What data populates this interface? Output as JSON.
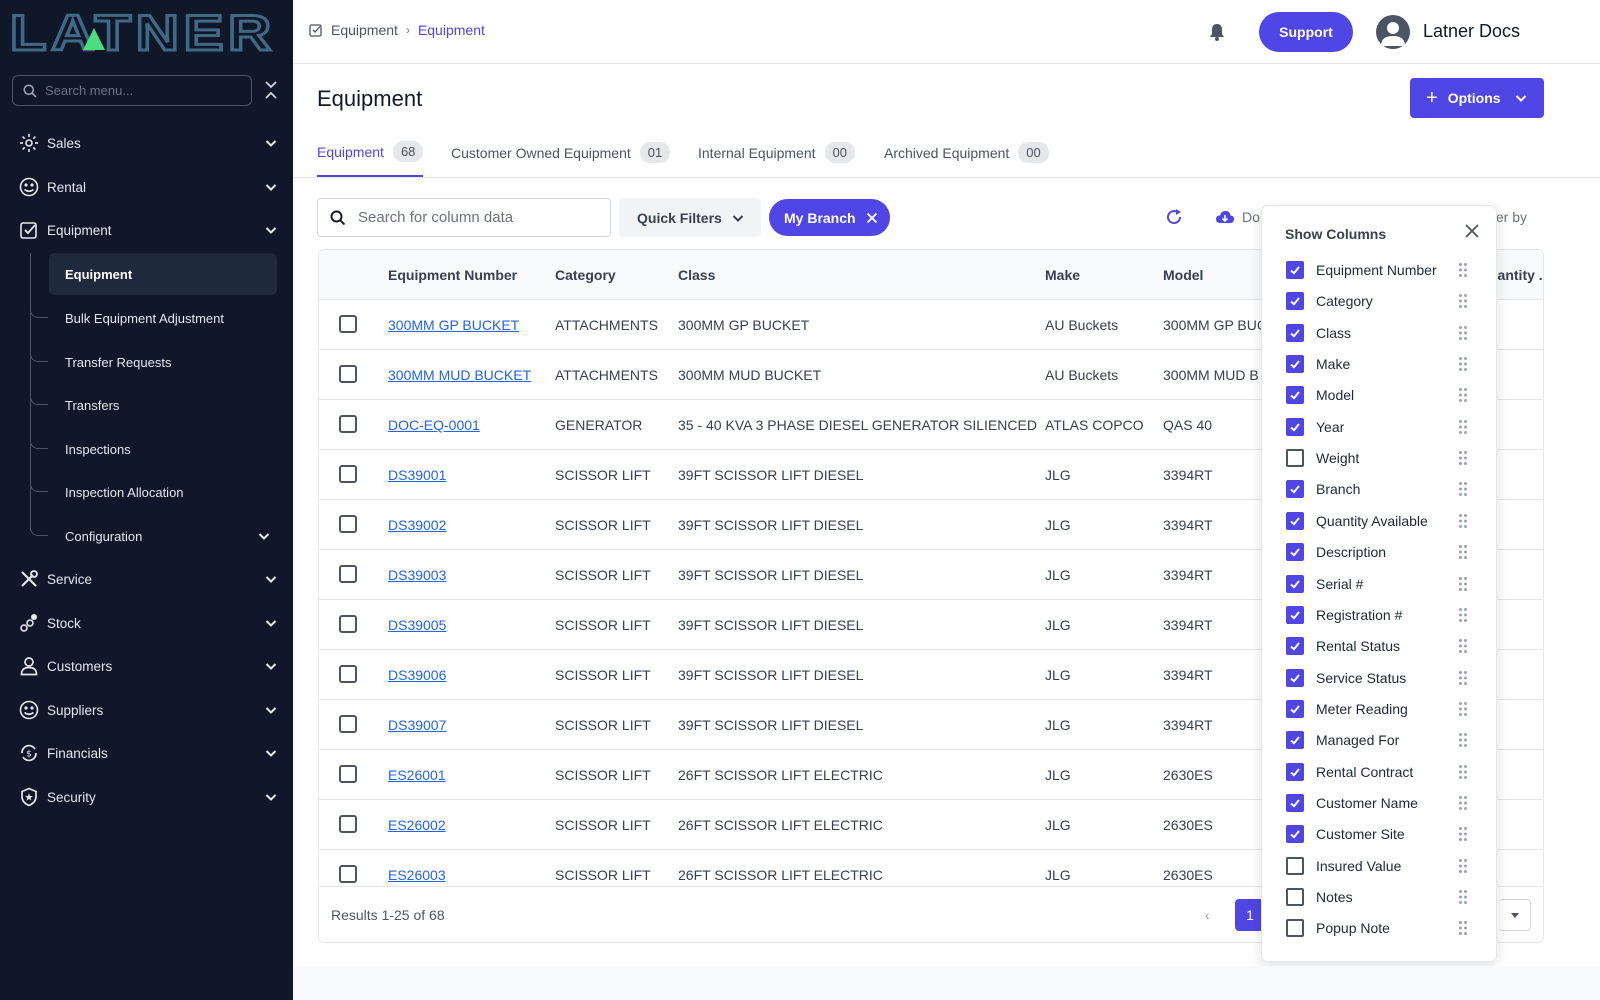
{
  "brand": {
    "logo_text": "LATNER",
    "accent": "#4f46e5",
    "sidebar_bg": "#0f1729"
  },
  "sidebar": {
    "search_placeholder": "Search menu...",
    "items": [
      {
        "label": "Sales",
        "icon": "sales-icon"
      },
      {
        "label": "Rental",
        "icon": "rental-icon"
      },
      {
        "label": "Equipment",
        "icon": "equipment-icon"
      },
      {
        "label": "Service",
        "icon": "service-icon"
      },
      {
        "label": "Stock",
        "icon": "stock-icon"
      },
      {
        "label": "Customers",
        "icon": "customers-icon"
      },
      {
        "label": "Suppliers",
        "icon": "suppliers-icon"
      },
      {
        "label": "Financials",
        "icon": "financials-icon"
      },
      {
        "label": "Security",
        "icon": "security-icon"
      }
    ],
    "equipment_sub": [
      {
        "label": "Equipment"
      },
      {
        "label": "Bulk Equipment Adjustment"
      },
      {
        "label": "Transfer Requests"
      },
      {
        "label": "Transfers"
      },
      {
        "label": "Inspections"
      },
      {
        "label": "Inspection Allocation"
      },
      {
        "label": "Configuration"
      }
    ]
  },
  "topbar": {
    "breadcrumb": [
      "Equipment",
      "Equipment"
    ],
    "support_label": "Support",
    "user_name": "Latner Docs"
  },
  "page": {
    "title": "Equipment",
    "options_label": "Options",
    "tabs": [
      {
        "label": "Equipment",
        "count": "68"
      },
      {
        "label": "Customer Owned Equipment",
        "count": "01"
      },
      {
        "label": "Internal Equipment",
        "count": "00"
      },
      {
        "label": "Archived Equipment",
        "count": "00"
      }
    ]
  },
  "toolbar": {
    "search_placeholder": "Search for column data",
    "quick_filters_label": "Quick Filters",
    "branch_chip_label": "My Branch",
    "download_label": "Do",
    "filter_label": "ter by"
  },
  "table": {
    "columns": [
      "Equipment Number",
      "Category",
      "Class",
      "Make",
      "Model",
      "uantity ."
    ],
    "rows": [
      [
        "300MM GP BUCKET",
        "ATTACHMENTS",
        "300MM GP BUCKET",
        "AU Buckets",
        "300MM GP BUC"
      ],
      [
        "300MM MUD BUCKET",
        "ATTACHMENTS",
        "300MM MUD BUCKET",
        "AU Buckets",
        "300MM MUD B"
      ],
      [
        "DOC-EQ-0001",
        "GENERATOR",
        "35 - 40 KVA 3 PHASE DIESEL GENERATOR SILIENCED",
        "ATLAS COPCO",
        "QAS 40"
      ],
      [
        "DS39001",
        "SCISSOR LIFT",
        "39FT SCISSOR LIFT DIESEL",
        "JLG",
        "3394RT"
      ],
      [
        "DS39002",
        "SCISSOR LIFT",
        "39FT SCISSOR LIFT DIESEL",
        "JLG",
        "3394RT"
      ],
      [
        "DS39003",
        "SCISSOR LIFT",
        "39FT SCISSOR LIFT DIESEL",
        "JLG",
        "3394RT"
      ],
      [
        "DS39005",
        "SCISSOR LIFT",
        "39FT SCISSOR LIFT DIESEL",
        "JLG",
        "3394RT"
      ],
      [
        "DS39006",
        "SCISSOR LIFT",
        "39FT SCISSOR LIFT DIESEL",
        "JLG",
        "3394RT"
      ],
      [
        "DS39007",
        "SCISSOR LIFT",
        "39FT SCISSOR LIFT DIESEL",
        "JLG",
        "3394RT"
      ],
      [
        "ES26001",
        "SCISSOR LIFT",
        "26FT SCISSOR LIFT ELECTRIC",
        "JLG",
        "2630ES"
      ],
      [
        "ES26002",
        "SCISSOR LIFT",
        "26FT SCISSOR LIFT ELECTRIC",
        "JLG",
        "2630ES"
      ],
      [
        "ES26003",
        "SCISSOR LIFT",
        "26FT SCISSOR LIFT ELECTRIC",
        "JLG",
        "2630ES"
      ]
    ],
    "results_text": "Results 1-25 of 68",
    "current_page": "1"
  },
  "show_columns": {
    "title": "Show Columns",
    "items": [
      {
        "label": "Equipment Number",
        "checked": true
      },
      {
        "label": "Category",
        "checked": true
      },
      {
        "label": "Class",
        "checked": true
      },
      {
        "label": "Make",
        "checked": true
      },
      {
        "label": "Model",
        "checked": true
      },
      {
        "label": "Year",
        "checked": true
      },
      {
        "label": "Weight",
        "checked": false
      },
      {
        "label": "Branch",
        "checked": true
      },
      {
        "label": "Quantity Available",
        "checked": true
      },
      {
        "label": "Description",
        "checked": true
      },
      {
        "label": "Serial #",
        "checked": true
      },
      {
        "label": "Registration #",
        "checked": true
      },
      {
        "label": "Rental Status",
        "checked": true
      },
      {
        "label": "Service Status",
        "checked": true
      },
      {
        "label": "Meter Reading",
        "checked": true
      },
      {
        "label": "Managed For",
        "checked": true
      },
      {
        "label": "Rental Contract",
        "checked": true
      },
      {
        "label": "Customer Name",
        "checked": true
      },
      {
        "label": "Customer Site",
        "checked": true
      },
      {
        "label": "Insured Value",
        "checked": false
      },
      {
        "label": "Notes",
        "checked": false
      },
      {
        "label": "Popup Note",
        "checked": false
      }
    ]
  }
}
